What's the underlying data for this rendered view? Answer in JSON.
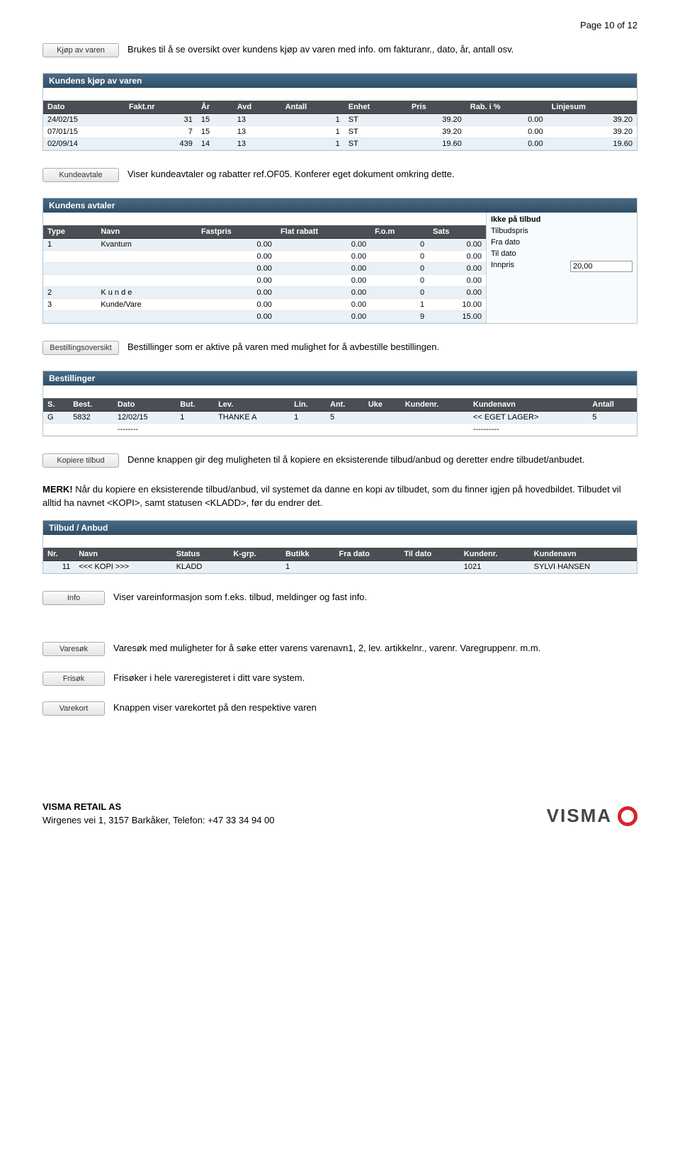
{
  "page_header": "Page 10 of 12",
  "sections": {
    "kjop": {
      "btn": "Kjøp av varen",
      "text": "Brukes til å se oversikt over kundens kjøp av varen med info. om fakturanr., dato, år, antall osv."
    },
    "kundeavtale": {
      "btn": "Kundeavtale",
      "text": "Viser kundeavtaler og rabatter ref.OF05. Konferer eget dokument omkring dette."
    },
    "bestilling": {
      "btn": "Bestillingsoversikt",
      "text": "Bestillinger som er aktive på varen med mulighet for å avbestille bestillingen."
    },
    "kopier": {
      "btn": "Kopiere tilbud",
      "text": "Denne knappen gir deg muligheten til å kopiere en eksisterende tilbud/anbud og deretter endre tilbudet/anbudet."
    },
    "merk_heading": "MERK!",
    "merk_text": " Når du kopiere en eksisterende tilbud/anbud, vil systemet da danne en kopi av tilbudet, som du finner igjen på hovedbildet. Tilbudet vil alltid ha navnet <KOPI>, samt statusen <KLADD>, før du endrer det.",
    "info": {
      "btn": "Info",
      "text": "Viser vareinformasjon som f.eks. tilbud, meldinger og fast info."
    },
    "varesok": {
      "btn": "Varesøk",
      "text": "Varesøk med muligheter for å søke etter varens varenavn1, 2, lev. artikkelnr., varenr. Varegruppenr. m.m."
    },
    "frisok": {
      "btn": "Frisøk",
      "text": "Frisøker i hele vareregisteret i ditt vare system."
    },
    "varekort": {
      "btn": "Varekort",
      "text": "Knappen viser varekortet på den respektive varen"
    }
  },
  "panel_kjop": {
    "title": "Kundens kjøp av varen",
    "headers": [
      "Dato",
      "Fakt.nr",
      "År",
      "Avd",
      "Antall",
      "Enhet",
      "Pris",
      "Rab. i %",
      "Linjesum"
    ],
    "rows": [
      [
        "24/02/15",
        "31",
        "15",
        "13",
        "1",
        "ST",
        "39.20",
        "0.00",
        "39.20"
      ],
      [
        "07/01/15",
        "7",
        "15",
        "13",
        "1",
        "ST",
        "39.20",
        "0.00",
        "39.20"
      ],
      [
        "02/09/14",
        "439",
        "14",
        "13",
        "1",
        "ST",
        "19.60",
        "0.00",
        "19.60"
      ]
    ]
  },
  "panel_avtaler": {
    "title": "Kundens avtaler",
    "headers": [
      "Type",
      "Navn",
      "Fastpris",
      "Flat rabatt",
      "F.o.m",
      "Sats"
    ],
    "rows": [
      [
        "1",
        "Kvantum",
        "0.00",
        "0.00",
        "0",
        "0.00"
      ],
      [
        "",
        "",
        "0.00",
        "0.00",
        "0",
        "0.00"
      ],
      [
        "",
        "",
        "0.00",
        "0.00",
        "0",
        "0.00"
      ],
      [
        "",
        "",
        "0.00",
        "0.00",
        "0",
        "0.00"
      ],
      [
        "2",
        "K u n d e",
        "0.00",
        "0.00",
        "0",
        "0.00"
      ],
      [
        "3",
        "Kunde/Vare",
        "0.00",
        "0.00",
        "1",
        "10.00"
      ],
      [
        "",
        "",
        "0.00",
        "0.00",
        "9",
        "15.00"
      ]
    ],
    "side": {
      "hdr": "Ikke på tilbud",
      "rows": [
        {
          "label": "Tilbudspris",
          "value": ""
        },
        {
          "label": "Fra dato",
          "value": ""
        },
        {
          "label": "Til dato",
          "value": ""
        },
        {
          "label": "Innpris",
          "value": "20,00"
        }
      ]
    }
  },
  "panel_bestillinger": {
    "title": "Bestillinger",
    "headers": [
      "S.",
      "Best.",
      "Dato",
      "But.",
      "Lev.",
      "Lin.",
      "Ant.",
      "Uke",
      "Kundenr.",
      "Kundenavn",
      "Antall"
    ],
    "rows": [
      [
        "G",
        "5832",
        "12/02/15",
        "1",
        "THANKE A",
        "1",
        "5",
        "",
        "",
        "<< EGET LAGER>",
        "5"
      ],
      [
        "",
        "",
        "--------",
        "",
        "",
        "",
        "",
        "",
        "",
        "----------",
        ""
      ]
    ]
  },
  "panel_tilbud": {
    "title": "Tilbud / Anbud",
    "headers": [
      "Nr.",
      "Navn",
      "Status",
      "K-grp.",
      "Butikk",
      "Fra dato",
      "Til dato",
      "Kundenr.",
      "Kundenavn"
    ],
    "rows": [
      [
        "11",
        "<<< KOPI >>>",
        "KLADD",
        "",
        "1",
        "",
        "",
        "1021",
        "SYLVI HANSEN"
      ]
    ]
  },
  "footer": {
    "company": "VISMA RETAIL AS",
    "address": "Wirgenes vei 1, 3157 Barkåker, Telefon: +47 33 34 94 00",
    "logo": "VISMA"
  }
}
